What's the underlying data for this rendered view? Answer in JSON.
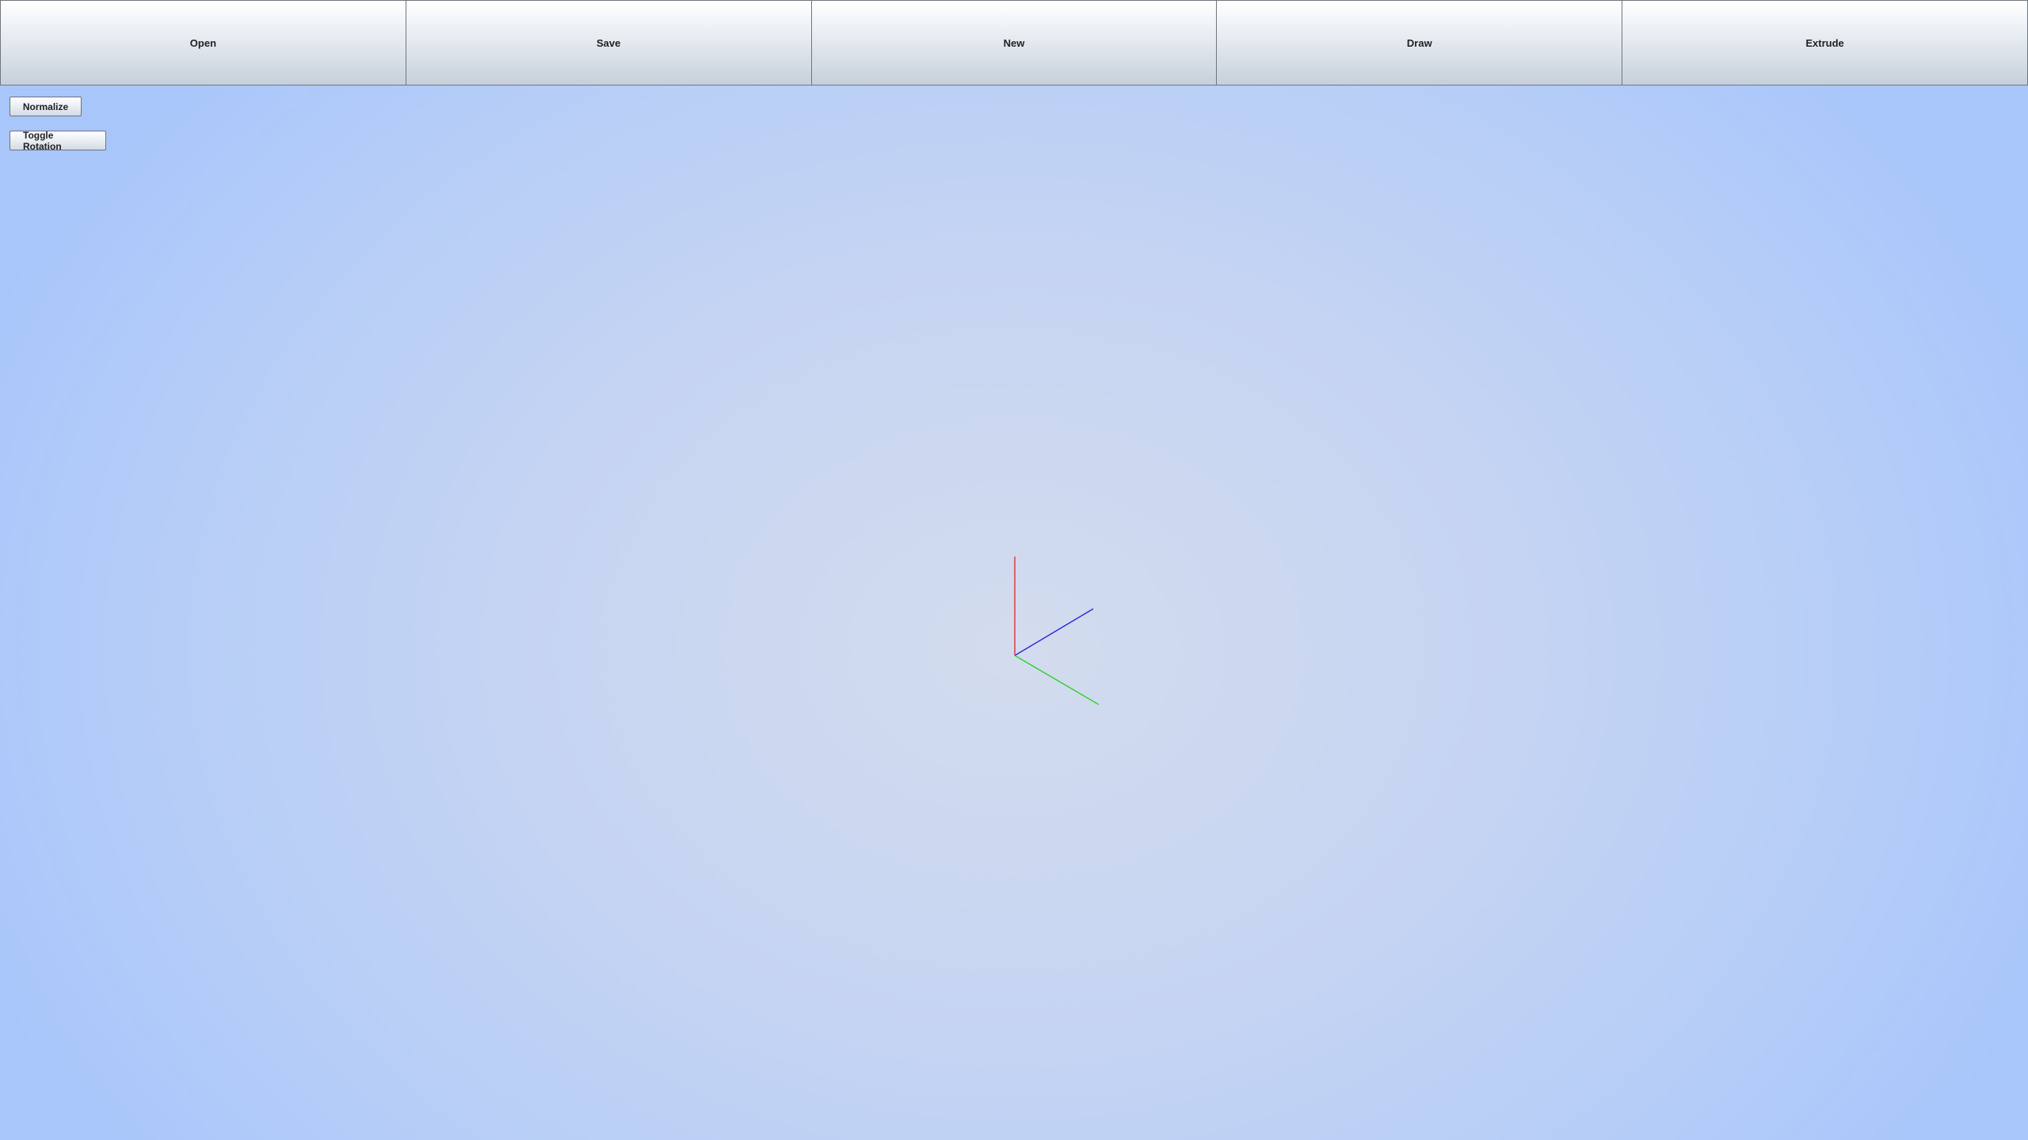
{
  "toolbar": {
    "open_label": "Open",
    "save_label": "Save",
    "new_label": "New",
    "draw_label": "Draw",
    "extrude_label": "Extrude"
  },
  "controls": {
    "normalize_label": "Normalize",
    "toggle_rotation_label": "Toggle Rotation"
  },
  "viewport": {
    "axis_colors": {
      "x": "#e0303a",
      "y": "#2fd02f",
      "z": "#2a2ad8"
    }
  }
}
